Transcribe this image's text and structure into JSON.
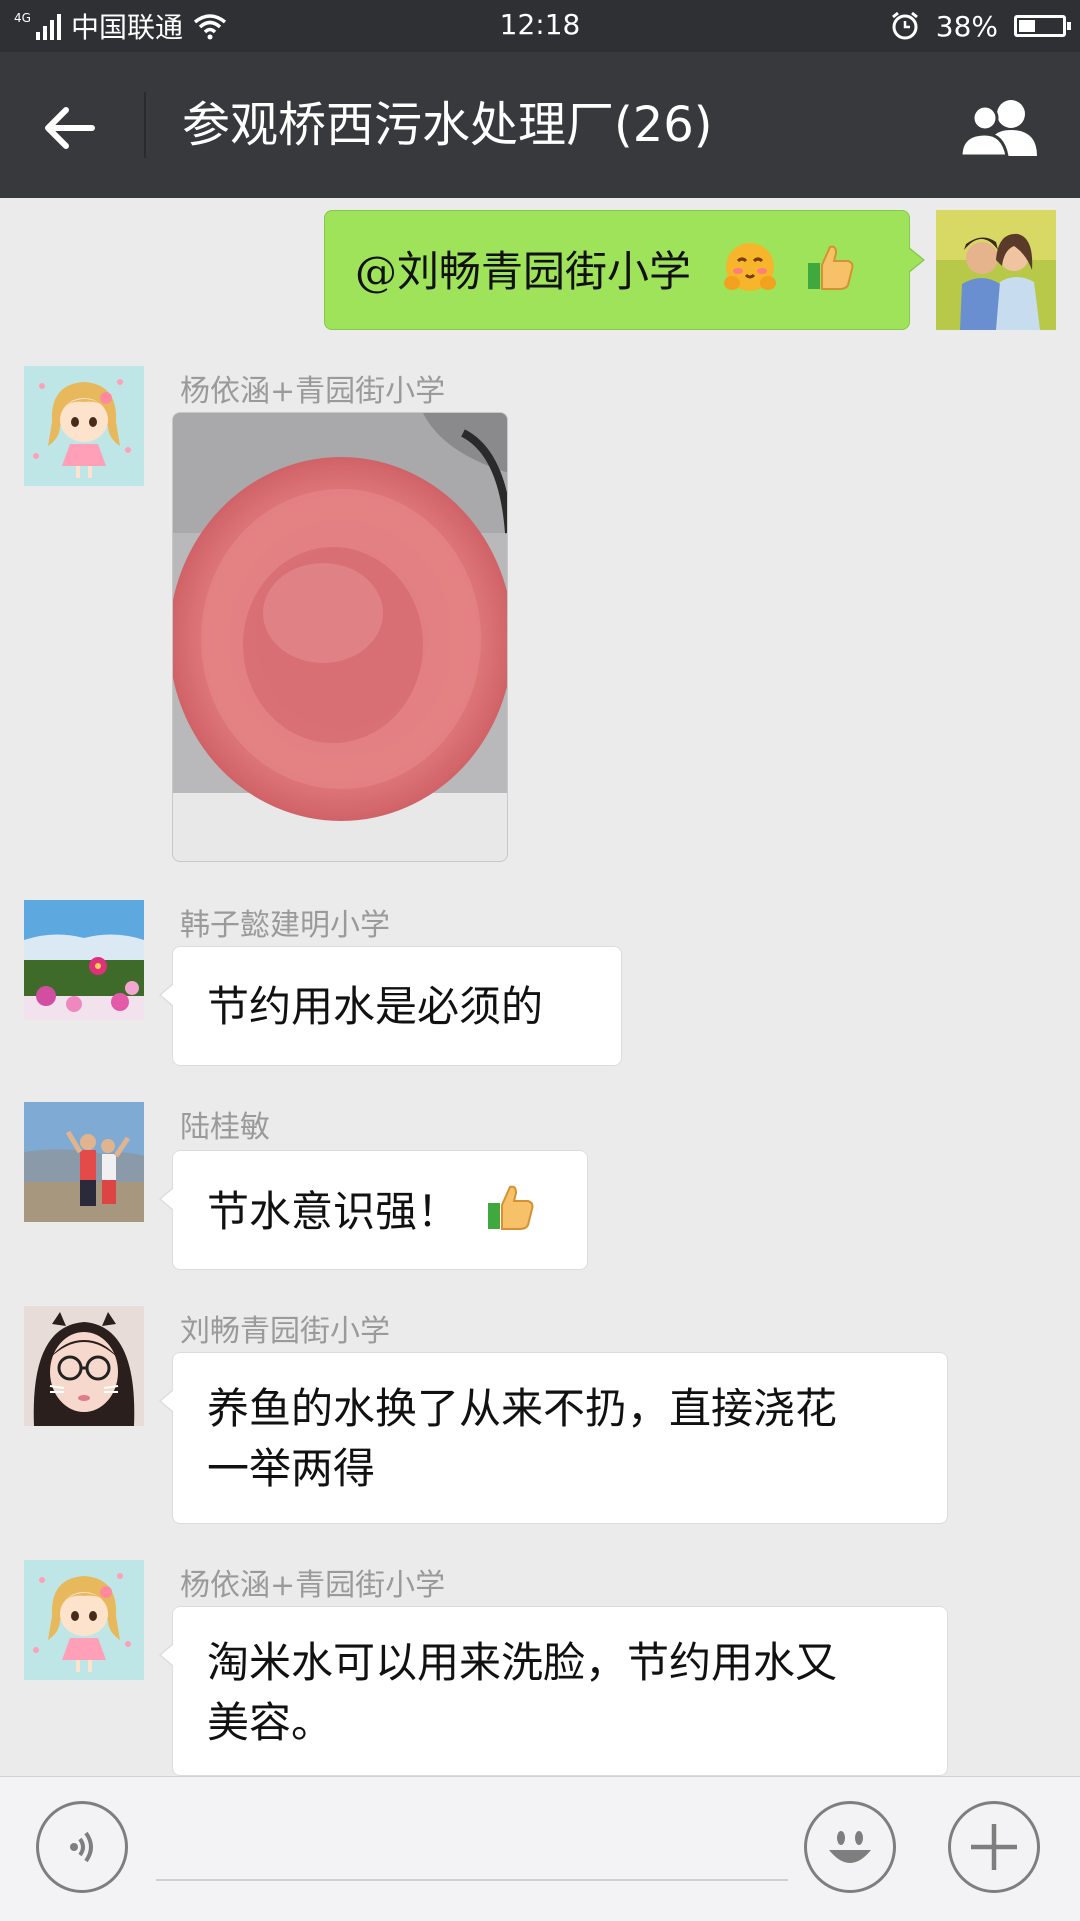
{
  "status_bar": {
    "network": "4G",
    "carrier": "中国联通",
    "time": "12:18",
    "battery": "38%",
    "battery_level": 0.38
  },
  "header": {
    "title": "参观桥西污水处理厂(26)",
    "back_icon": "arrow-left-icon",
    "members_icon": "group-members-icon"
  },
  "messages": [
    {
      "side": "right",
      "text": "@刘畅青园街小学",
      "emoji": [
        "hug-face-emoji",
        "thumbs-up-emoji"
      ]
    },
    {
      "side": "left",
      "sender": "杨依涵+青园街小学",
      "type": "image",
      "image_desc_icon": "pink-plastic-basin-photo"
    },
    {
      "side": "left",
      "sender": "韩子懿建明小学",
      "text": "节约用水是必须的"
    },
    {
      "side": "left",
      "sender": "陆桂敏",
      "text": "节水意识强！",
      "emoji": [
        "thumbs-up-emoji"
      ]
    },
    {
      "side": "left",
      "sender": "刘畅青园街小学",
      "text_lines": [
        "养鱼的水换了从来不扔，直接浇花",
        "一举两得"
      ]
    },
    {
      "side": "left",
      "sender": "杨依涵+青园街小学",
      "text_lines": [
        "淘米水可以用来洗脸，节约用水又",
        "美容。"
      ]
    }
  ],
  "input_bar": {
    "voice_icon": "voice-input-icon",
    "emoji_icon": "smiley-icon",
    "plus_icon": "plus-icon",
    "input_value": ""
  },
  "colors": {
    "status_bar": "#2e3033",
    "title_bar": "#37393c",
    "chat_background": "#ebebeb",
    "own_bubble": "#9fe35a",
    "other_bubble": "#ffffff"
  }
}
